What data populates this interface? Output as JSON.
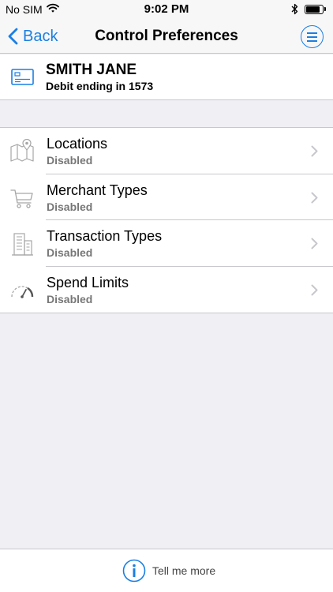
{
  "status_bar": {
    "carrier": "No SIM",
    "time": "9:02 PM",
    "battery_level": 0.85
  },
  "nav": {
    "back_label": "Back",
    "title": "Control Preferences"
  },
  "account": {
    "name": "SMITH JANE",
    "description": "Debit ending in 1573"
  },
  "controls": [
    {
      "title": "Locations",
      "status": "Disabled",
      "icon": "map-icon"
    },
    {
      "title": "Merchant Types",
      "status": "Disabled",
      "icon": "cart-icon"
    },
    {
      "title": "Transaction Types",
      "status": "Disabled",
      "icon": "building-icon"
    },
    {
      "title": "Spend Limits",
      "status": "Disabled",
      "icon": "gauge-icon"
    }
  ],
  "footer": {
    "label": "Tell me more"
  },
  "colors": {
    "accent": "#1a7fe3",
    "background": "#efeff4",
    "icon_gray": "#a6a6a6"
  }
}
